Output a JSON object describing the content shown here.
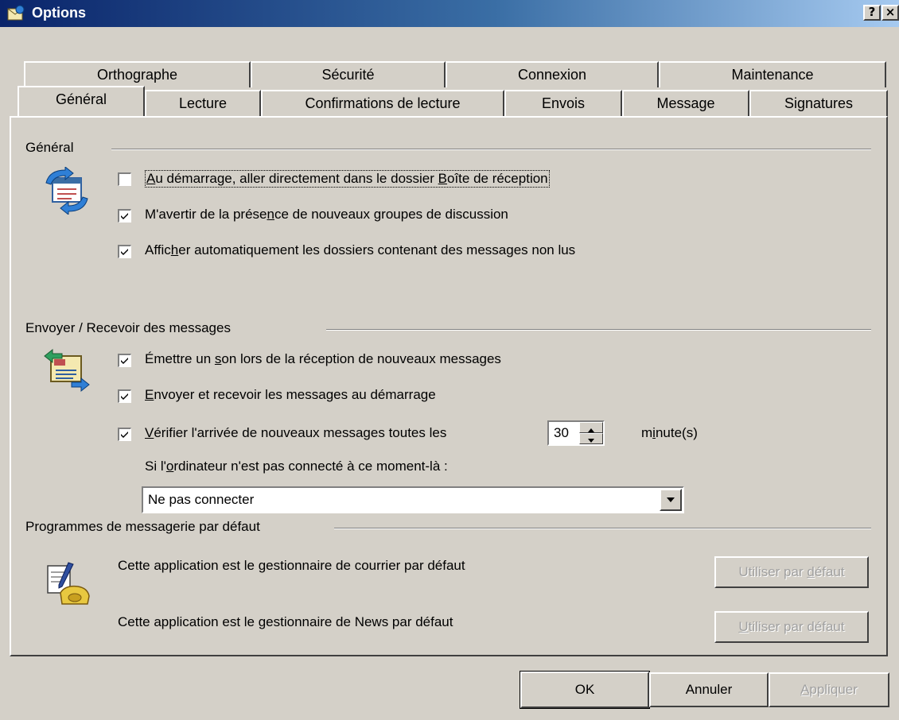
{
  "window": {
    "title": "Options",
    "help_label": "?",
    "close_label": "×"
  },
  "tabs_row1": [
    "Orthographe",
    "Sécurité",
    "Connexion",
    "Maintenance"
  ],
  "tabs_row2": [
    "Général",
    "Lecture",
    "Confirmations de lecture",
    "Envois",
    "Message",
    "Signatures"
  ],
  "selected_tab": "Général",
  "general": {
    "title": "Général",
    "options": [
      {
        "pre": "",
        "ul": "A",
        "post": "u démarrage, aller directement dans le dossier ",
        "ul2": "B",
        "post2": "oîte de réception",
        "checked": false
      },
      {
        "pre": "M'avertir de la prése",
        "ul": "n",
        "post": "ce de nouveaux groupes de discussion",
        "checked": true
      },
      {
        "pre": "Affic",
        "ul": "h",
        "post": "er automatiquement les dossiers contenant des messages non lus",
        "checked": true
      }
    ]
  },
  "send_receive": {
    "title": "Envoyer / Recevoir des messages",
    "sound": {
      "pre": "Émettre un ",
      "ul": "s",
      "post": "on lors de la réception de nouveaux messages",
      "checked": true
    },
    "startup": {
      "pre": "",
      "ul": "E",
      "post": "nvoyer et recevoir les messages au démarrage",
      "checked": true
    },
    "check": {
      "pre": "",
      "ul": "V",
      "post": "érifier l'arrivée de nouveaux messages toutes les",
      "checked": true
    },
    "interval_value": "30",
    "unit": {
      "pre": "m",
      "ul": "i",
      "post": "nute(s)"
    },
    "not_connected": {
      "pre": "Si l'",
      "ul": "o",
      "post": "rdinateur n'est pas connecté à ce moment-là :"
    },
    "connect_select": "Ne pas connecter"
  },
  "default_programs": {
    "title": "Programmes de messagerie par défaut",
    "mail_text": "Cette application est le gestionnaire de courrier par défaut",
    "news_text": "Cette application est le gestionnaire de News par défaut",
    "mail_button": {
      "pre": "Utiliser par ",
      "ul": "d",
      "post": "éfaut"
    },
    "news_button": {
      "pre": "",
      "ul": "U",
      "post": "tiliser par défaut"
    }
  },
  "footer": {
    "ok": "OK",
    "cancel": "Annuler",
    "apply": {
      "pre": "",
      "ul": "A",
      "post": "ppliquer"
    }
  }
}
